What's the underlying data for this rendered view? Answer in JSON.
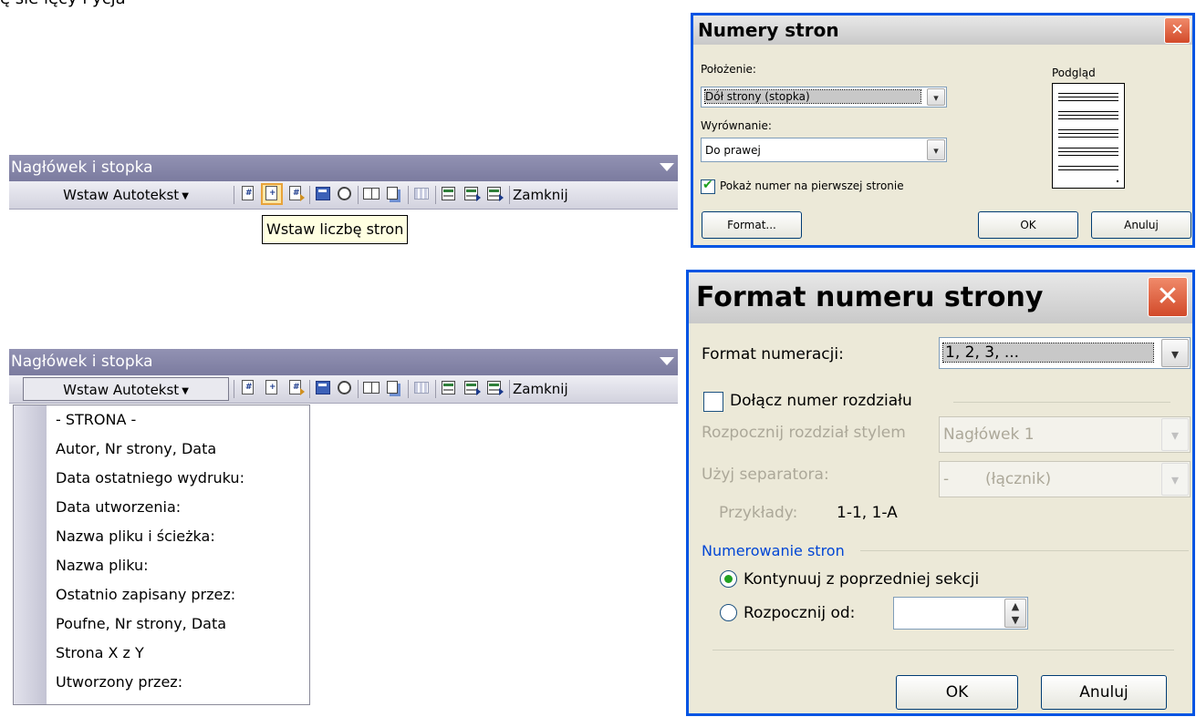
{
  "top_text": "ę sie ięcy i ycja",
  "toolbar": {
    "title": "Nagłówek i stopka",
    "autotext_label": "Wstaw Autotekst",
    "autotext_underline": "u",
    "close_label": "Zamknij",
    "icons": [
      "insert-page-number-icon",
      "insert-page-count-icon",
      "format-page-number-icon",
      "insert-date-icon",
      "insert-time-icon",
      "page-setup-icon",
      "show-hide-text-icon",
      "same-as-previous-icon",
      "switch-header-footer-icon",
      "show-previous-icon",
      "show-next-icon"
    ]
  },
  "tooltip": "Wstaw liczbę stron",
  "autotext_menu": {
    "items": [
      "- STRONA -",
      "Autor, Nr strony, Data",
      "Data ostatniego wydruku:",
      "Data utworzenia:",
      "Nazwa pliku i ścieżka:",
      "Nazwa pliku:",
      "Ostatnio zapisany przez:",
      "Poufne, Nr strony, Data",
      "Strona X z Y",
      "Utworzony przez:"
    ]
  },
  "page_numbers_dialog": {
    "title": "Numery stron",
    "position_label": "Położenie:",
    "position_value": "Dół strony (stopka)",
    "alignment_label": "Wyrównanie:",
    "alignment_value": "Do prawej",
    "show_first_page_label": "Pokaż numer na pierwszej stronie",
    "show_first_page_checked": true,
    "preview_label": "Podgląd",
    "format_button": "Format...",
    "ok_button": "OK",
    "cancel_button": "Anuluj"
  },
  "format_dialog": {
    "title": "Format numeru strony",
    "number_format_label": "Format numeracji:",
    "number_format_value": "1, 2, 3, ...",
    "include_chapter_label": "Dołącz numer rozdziału",
    "include_chapter_checked": false,
    "chapter_style_label": "Rozpocznij rozdział stylem",
    "chapter_style_value": "Nagłówek 1",
    "separator_label": "Użyj separatora:",
    "separator_value": "-",
    "separator_name": "(łącznik)",
    "examples_label": "Przykłady:",
    "examples_value": "1-1, 1-A",
    "numbering_group": "Numerowanie stron",
    "continue_label": "Kontynuuj z poprzedniej sekcji",
    "continue_checked": true,
    "start_at_label": "Rozpocznij od:",
    "start_at_value": "",
    "ok_button": "OK",
    "cancel_button": "Anuluj"
  },
  "colors": {
    "toolbar_title_bg": "#8585a8",
    "dialog_border": "#0054e3",
    "dialog_bg": "#ece9d8",
    "close_red": "#d24a2a",
    "check_green": "#21a121",
    "group_blue": "#0046d5"
  }
}
